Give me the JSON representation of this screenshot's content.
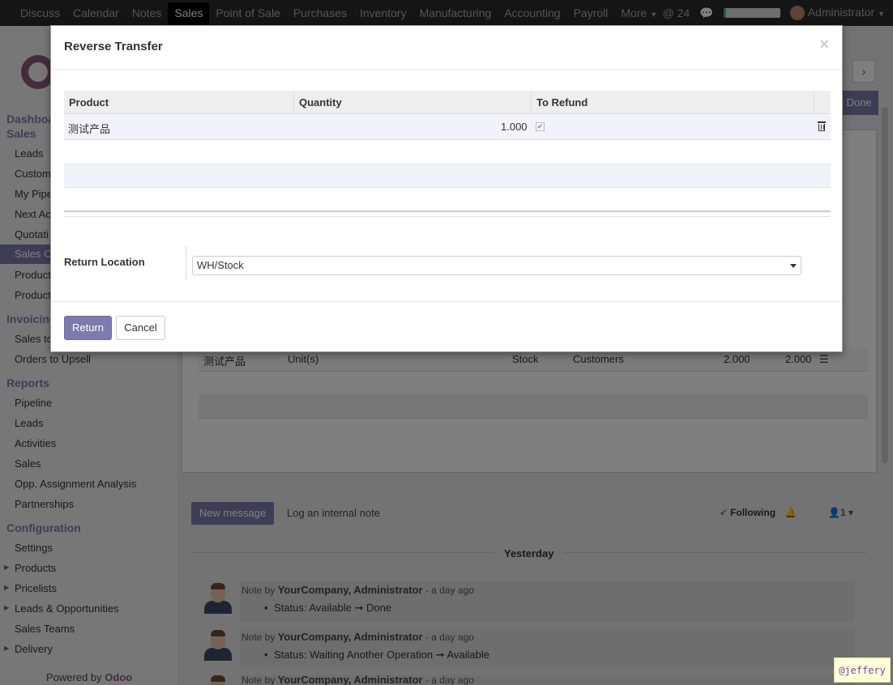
{
  "topbar": {
    "menu": [
      "Discuss",
      "Calendar",
      "Notes",
      "Sales",
      "Point of Sale",
      "Purchases",
      "Inventory",
      "Manufacturing",
      "Accounting",
      "Payroll",
      "More"
    ],
    "active": "Sales",
    "mentions": "24",
    "progress": 0.05,
    "user": "Administrator"
  },
  "sidebar": {
    "sec_dashboard": "Dashboa",
    "sec_sales": "Sales",
    "items_sales": [
      "Leads",
      "Custom",
      "My Pipe",
      "Next Ac",
      "Quotati",
      "Sales O",
      "Product",
      "Product"
    ],
    "sec_invoicing": "Invoicing",
    "items_invoicing": [
      "Sales to",
      "Orders to Upsell"
    ],
    "sec_reports": "Reports",
    "items_reports": [
      "Pipeline",
      "Leads",
      "Activities",
      "Sales",
      "Opp. Assignment Analysis",
      "Partnerships"
    ],
    "sec_config": "Configuration",
    "items_config": [
      "Settings",
      "Products",
      "Pricelists",
      "Leads & Opportunities",
      "Sales Teams",
      "Delivery"
    ],
    "powered_by": "Powered by",
    "powered_brand": "Odoo"
  },
  "background": {
    "done_label": "Done",
    "row": {
      "product": "测试产品",
      "uom": "Unit(s)",
      "src": "Stock",
      "dest": "Customers",
      "qty1": "2.000",
      "qty2": "2.000"
    },
    "new_message": "New message",
    "log_note": "Log an internal note",
    "following": "Following",
    "followers": "1",
    "day": "Yesterday",
    "messages": [
      {
        "prefix": "Note by",
        "author": "YourCompany, Administrator",
        "when": "- a day ago",
        "status": "Status: Available ➞ Done"
      },
      {
        "prefix": "Note by",
        "author": "YourCompany, Administrator",
        "when": "- a day ago",
        "status": "Status: Waiting Another Operation ➞ Available"
      },
      {
        "prefix": "Note by",
        "author": "YourCompany, Administrator",
        "when": "- a day ago",
        "status": ""
      }
    ]
  },
  "modal": {
    "title": "Reverse Transfer",
    "close": "×",
    "columns": {
      "product": "Product",
      "quantity": "Quantity",
      "refund": "To Refund"
    },
    "row": {
      "product": "测试产品",
      "quantity": "1.000",
      "refund_checked": true
    },
    "return_location_label": "Return Location",
    "return_location_value": "WH/Stock",
    "return_btn": "Return",
    "cancel_btn": "Cancel"
  },
  "watermark": "@jeffery"
}
